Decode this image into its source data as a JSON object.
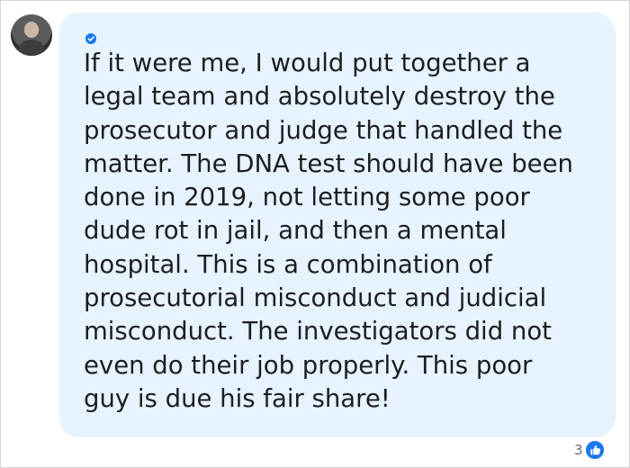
{
  "comment": {
    "verified_badge_icon": "verified-check-icon",
    "text": "If it were me, I would put together a\nlegal team and absolutely destroy the\nprosecutor and judge that handled the\nmatter. The DNA test should have been\ndone in 2019, not letting some poor\ndude rot in jail, and then a mental\nhospital. This is a combination of\nprosecutorial misconduct and judicial\nmisconduct. The investigators did not\neven do their job properly. This poor\nguy is due his fair share!"
  },
  "reactions": {
    "count": "3",
    "icon": "like-thumbs-up-icon"
  },
  "colors": {
    "bubble": "#e7f3ff",
    "text": "#1c1e21",
    "accent": "#1877f2",
    "muted": "#65676b"
  }
}
